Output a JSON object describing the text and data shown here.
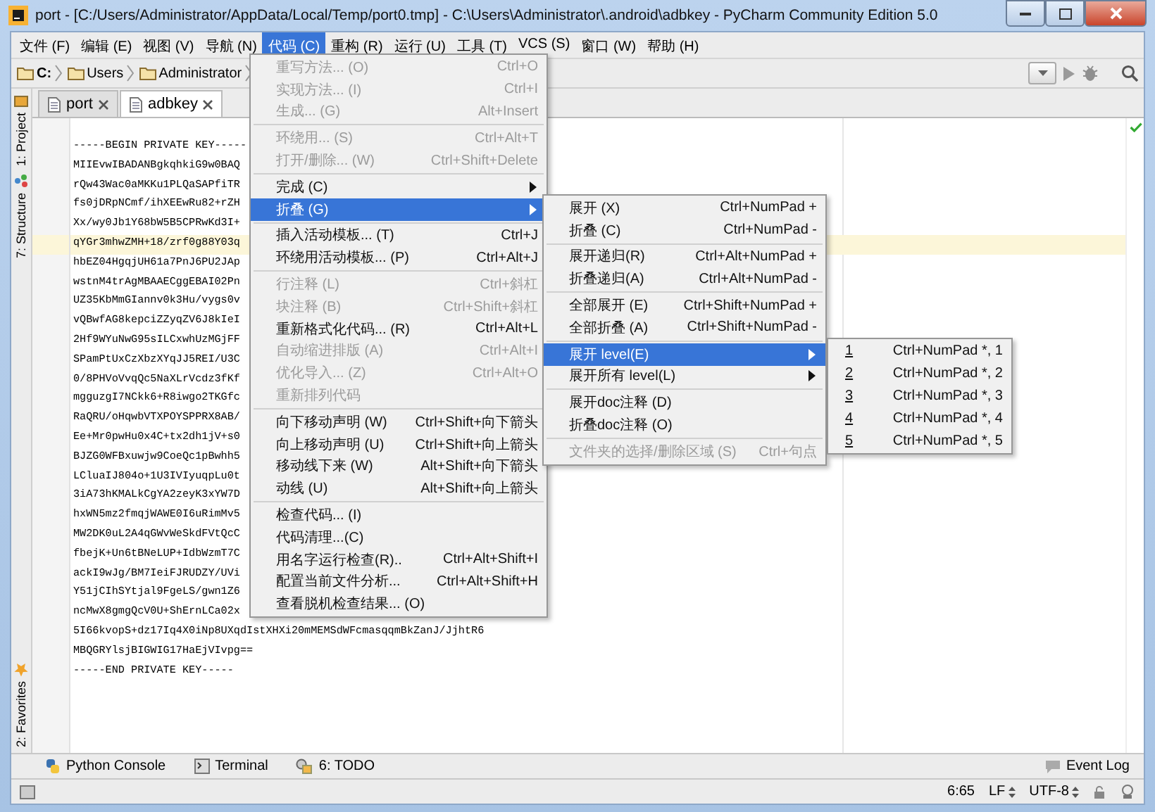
{
  "window": {
    "title": "port - [C:/Users/Administrator/AppData/Local/Temp/port0.tmp] - C:\\Users\\Administrator\\.android\\adbkey - PyCharm Community Edition 5.0"
  },
  "menu_bar": [
    {
      "label": "文件 (F)",
      "selected": false
    },
    {
      "label": "编辑 (E)",
      "selected": false
    },
    {
      "label": "视图 (V)",
      "selected": false
    },
    {
      "label": "导航 (N)",
      "selected": false
    },
    {
      "label": "代码 (C)",
      "selected": true
    },
    {
      "label": "重构 (R)",
      "selected": false
    },
    {
      "label": "运行 (U)",
      "selected": false
    },
    {
      "label": "工具 (T)",
      "selected": false
    },
    {
      "label": "VCS (S)",
      "selected": false
    },
    {
      "label": "窗口 (W)",
      "selected": false
    },
    {
      "label": "帮助 (H)",
      "selected": false
    }
  ],
  "breadcrumbs": [
    "C:",
    "Users",
    "Administrator"
  ],
  "left_tabs": [
    "1: Project",
    "7: Structure"
  ],
  "left_bottom_tabs": [
    "2: Favorites"
  ],
  "tabs": [
    {
      "label": "port",
      "selected": false
    },
    {
      "label": "adbkey",
      "selected": true
    }
  ],
  "editor": {
    "lines": [
      {
        "text": "-----BEGIN PRIVATE KEY-----",
        "current": false
      },
      {
        "text": "MIIEvwIBADANBgkqhkiG9w0BAQ",
        "current": false
      },
      {
        "text": "rQw43Wac0aMKKu1PLQaSAPfiTR",
        "current": false
      },
      {
        "text": "fs0jDRpNCmf/ihXEEwRu82+rZH",
        "current": false
      },
      {
        "text": "Xx/wy0Jb1Y68bW5B5CPRwKd3I+",
        "current": false
      },
      {
        "text": "qYGr3mhwZMH+18/zrf0g88Y03q",
        "current": true
      },
      {
        "text": "hbEZ04HgqjUH61a7PnJ6PU2JAp",
        "current": false
      },
      {
        "text": "wstnM4trAgMBAAECggEBAI02Pn",
        "current": false
      },
      {
        "text": "UZ35KbMmGIannv0k3Hu/vygs0v",
        "current": false
      },
      {
        "text": "vQBwfAG8kepciZZyqZV6J8kIeI",
        "current": false
      },
      {
        "text": "2Hf9WYuNwG95sILCxwhUzMGjFF",
        "current": false
      },
      {
        "text": "SPamPtUxCzXbzXYqJJ5REI/U3C",
        "current": false
      },
      {
        "text": "0/8PHVoVvqQc5NaXLrVcdz3fKf",
        "current": false
      },
      {
        "text": "mgguzgI7NCkk6+R8iwgo2TKGfc",
        "current": false
      },
      {
        "text": "RaQRU/oHqwbVTXPOYSPPRX8AB/",
        "current": false
      },
      {
        "text": "Ee+Mr0pwHu0x4C+tx2dh1jV+s0",
        "current": false
      },
      {
        "text": "BJZG0WFBxuwjw9CoeQc1pBwhh5",
        "current": false
      },
      {
        "text": "LCluaIJ804o+1U3IVIyuqpLu0t",
        "current": false
      },
      {
        "text": "3iA73hKMALkCgYA2zeyK3xYW7D",
        "current": false
      },
      {
        "text": "hxWN5mz2fmqjWAWE0I6uRimMv5",
        "current": false
      },
      {
        "text": "MW2DK0uL2A4qGWvWeSkdFVtQcC",
        "current": false
      },
      {
        "text": "fbejK+Un6tBNeLUP+IdbWzmT7C",
        "current": false
      },
      {
        "text": "ackI9wJg/BM7IeiFJRUDZY/UVi",
        "current": false
      },
      {
        "text": "Y51jCIhSYtjal9FgeLS/gwn1Z6",
        "current": false
      },
      {
        "text": "ncMwX8gmgQcV0U+ShErnLCa02x",
        "current": false
      },
      {
        "text": "5I66kvopS+dz17Iq4X0iNp8UXqdIstXHXi20mMEMSdWFcmasqqmBkZanJ/JjhtR6",
        "current": false
      },
      {
        "text": "MBQGRYlsjBIGWIG17HaEjVIvpg==",
        "current": false
      },
      {
        "text": "-----END PRIVATE KEY-----",
        "current": false
      }
    ]
  },
  "code_menu": {
    "groups": [
      {
        "items": [
          {
            "label": "重写方法... (O)",
            "shortcut": "Ctrl+O",
            "disabled": true,
            "submenu": false,
            "selected": false
          },
          {
            "label": "实现方法... (I)",
            "shortcut": "Ctrl+I",
            "disabled": true,
            "submenu": false,
            "selected": false
          },
          {
            "label": "生成... (G)",
            "shortcut": "Alt+Insert",
            "disabled": true,
            "submenu": false,
            "selected": false
          }
        ]
      },
      {
        "items": [
          {
            "label": "环绕用... (S)",
            "shortcut": "Ctrl+Alt+T",
            "disabled": true,
            "submenu": false,
            "selected": false
          },
          {
            "label": "打开/删除... (W)",
            "shortcut": "Ctrl+Shift+Delete",
            "disabled": true,
            "submenu": false,
            "selected": false
          }
        ]
      },
      {
        "items": [
          {
            "label": "完成 (C)",
            "disabled": false,
            "submenu": true,
            "selected": false
          },
          {
            "label": "折叠 (G)",
            "disabled": false,
            "submenu": true,
            "selected": true
          }
        ]
      },
      {
        "items": [
          {
            "label": "插入活动模板... (T)",
            "shortcut": "Ctrl+J",
            "disabled": false,
            "submenu": false,
            "selected": false
          },
          {
            "label": "环绕用活动模板... (P)",
            "shortcut": "Ctrl+Alt+J",
            "disabled": false,
            "submenu": false,
            "selected": false
          }
        ]
      },
      {
        "items": [
          {
            "label": "行注释 (L)",
            "shortcut": "Ctrl+斜杠",
            "disabled": true,
            "submenu": false,
            "selected": false
          },
          {
            "label": "块注释 (B)",
            "shortcut": "Ctrl+Shift+斜杠",
            "disabled": true,
            "submenu": false,
            "selected": false
          },
          {
            "label": "重新格式化代码... (R)",
            "shortcut": "Ctrl+Alt+L",
            "disabled": false,
            "submenu": false,
            "selected": false
          },
          {
            "label": "自动缩进排版 (A)",
            "shortcut": "Ctrl+Alt+I",
            "disabled": true,
            "submenu": false,
            "selected": false
          },
          {
            "label": "优化导入... (Z)",
            "shortcut": "Ctrl+Alt+O",
            "disabled": true,
            "submenu": false,
            "selected": false
          },
          {
            "label": "重新排列代码",
            "disabled": true,
            "submenu": false,
            "selected": false
          }
        ]
      },
      {
        "items": [
          {
            "label": "向下移动声明 (W)",
            "shortcut": "Ctrl+Shift+向下箭头",
            "disabled": false,
            "submenu": false,
            "selected": false
          },
          {
            "label": "向上移动声明 (U)",
            "shortcut": "Ctrl+Shift+向上箭头",
            "disabled": false,
            "submenu": false,
            "selected": false
          },
          {
            "label": "移动线下来 (W)",
            "shortcut": "Alt+Shift+向下箭头",
            "disabled": false,
            "submenu": false,
            "selected": false
          },
          {
            "label": "动线 (U)",
            "shortcut": "Alt+Shift+向上箭头",
            "disabled": false,
            "submenu": false,
            "selected": false
          }
        ]
      },
      {
        "items": [
          {
            "label": "检查代码... (I)",
            "disabled": false,
            "submenu": false,
            "selected": false
          },
          {
            "label": "代码清理...(C)",
            "disabled": false,
            "submenu": false,
            "selected": false
          },
          {
            "label": "用名字运行检查(R)..",
            "shortcut": "Ctrl+Alt+Shift+I",
            "disabled": false,
            "submenu": false,
            "selected": false
          },
          {
            "label": "配置当前文件分析...",
            "shortcut": "Ctrl+Alt+Shift+H",
            "disabled": false,
            "submenu": false,
            "selected": false
          },
          {
            "label": "查看脱机检查结果... (O)",
            "disabled": false,
            "submenu": false,
            "selected": false
          }
        ]
      }
    ]
  },
  "fold_menu": {
    "groups": [
      {
        "items": [
          {
            "label": "展开 (X)",
            "shortcut": "Ctrl+NumPad +",
            "disabled": false,
            "submenu": false,
            "selected": false
          },
          {
            "label": "折叠 (C)",
            "shortcut": "Ctrl+NumPad -",
            "disabled": false,
            "submenu": false,
            "selected": false
          }
        ]
      },
      {
        "items": [
          {
            "label": "展开递归(R)",
            "shortcut": "Ctrl+Alt+NumPad +",
            "disabled": false,
            "submenu": false,
            "selected": false
          },
          {
            "label": "折叠递归(A)",
            "shortcut": "Ctrl+Alt+NumPad -",
            "disabled": false,
            "submenu": false,
            "selected": false
          }
        ]
      },
      {
        "items": [
          {
            "label": "全部展开 (E)",
            "shortcut": "Ctrl+Shift+NumPad +",
            "disabled": false,
            "submenu": false,
            "selected": false
          },
          {
            "label": "全部折叠 (A)",
            "shortcut": "Ctrl+Shift+NumPad -",
            "disabled": false,
            "submenu": false,
            "selected": false
          }
        ]
      },
      {
        "items": [
          {
            "label": "展开 level(E)",
            "disabled": false,
            "submenu": true,
            "selected": true
          },
          {
            "label": "展开所有 level(L)",
            "disabled": false,
            "submenu": true,
            "selected": false
          }
        ]
      },
      {
        "items": [
          {
            "label": "展开doc注释 (D)",
            "disabled": false,
            "submenu": false,
            "selected": false
          },
          {
            "label": "折叠doc注释 (O)",
            "disabled": false,
            "submenu": false,
            "selected": false
          }
        ]
      },
      {
        "items": [
          {
            "label": "文件夹的选择/删除区域 (S)",
            "shortcut": "Ctrl+句点",
            "disabled": true,
            "submenu": false,
            "selected": false
          }
        ]
      }
    ]
  },
  "level_menu": {
    "items": [
      {
        "label": "1",
        "shortcut": "Ctrl+NumPad *, 1",
        "selected": false
      },
      {
        "label": "2",
        "shortcut": "Ctrl+NumPad *, 2",
        "selected": false
      },
      {
        "label": "3",
        "shortcut": "Ctrl+NumPad *, 3",
        "selected": false
      },
      {
        "label": "4",
        "shortcut": "Ctrl+NumPad *, 4",
        "selected": false
      },
      {
        "label": "5",
        "shortcut": "Ctrl+NumPad *, 5",
        "selected": false
      }
    ]
  },
  "tool_windows": [
    {
      "label": "Python Console",
      "kind": "python"
    },
    {
      "label": "Terminal",
      "kind": "terminal"
    },
    {
      "label": "6: TODO",
      "kind": "todo"
    }
  ],
  "event_log": "Event Log",
  "status_bar": {
    "position": "6:65",
    "line_separator": "LF",
    "encoding": "UTF-8"
  }
}
